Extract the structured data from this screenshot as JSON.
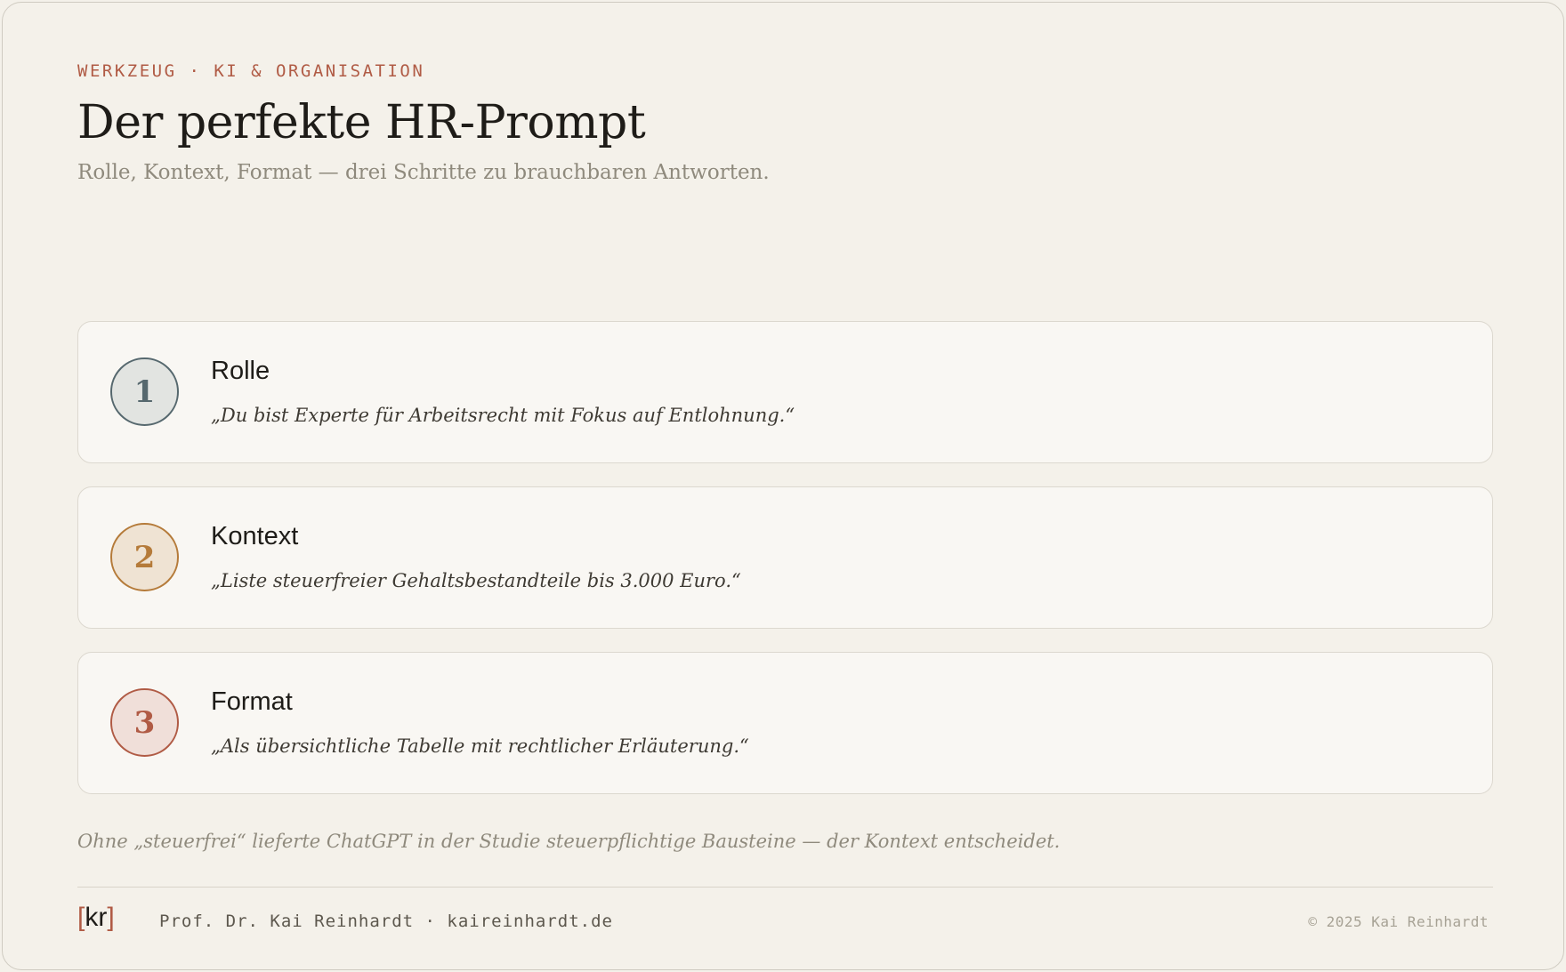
{
  "header": {
    "eyebrow": "WERKZEUG · KI & ORGANISATION",
    "title": "Der perfekte HR-Prompt",
    "subtitle": "Rolle, Kontext, Format — drei Schritte zu brauchbaren Antworten."
  },
  "steps": [
    {
      "number": "1",
      "title": "Rolle",
      "quote": "„Du bist Experte für Arbeitsrecht mit Fokus auf Entlohnung.“",
      "color": "#56686e"
    },
    {
      "number": "2",
      "title": "Kontext",
      "quote": "„Liste steuerfreier Gehaltsbestandteile bis 3.000 Euro.“",
      "color": "#b57b3a"
    },
    {
      "number": "3",
      "title": "Format",
      "quote": "„Als übersichtliche Tabelle mit rechtlicher Erläuterung.“",
      "color": "#b05b45"
    }
  ],
  "note": "Ohne „steuerfrei“ lieferte ChatGPT in der Studie steuerpflichtige Bausteine — der Kontext entscheidet.",
  "footer": {
    "logo_open": "[",
    "logo_text": "kr",
    "logo_close": "]",
    "author": "Prof. Dr. Kai Reinhardt · kaireinhardt.de",
    "copyright": "© 2025 Kai Reinhardt"
  }
}
